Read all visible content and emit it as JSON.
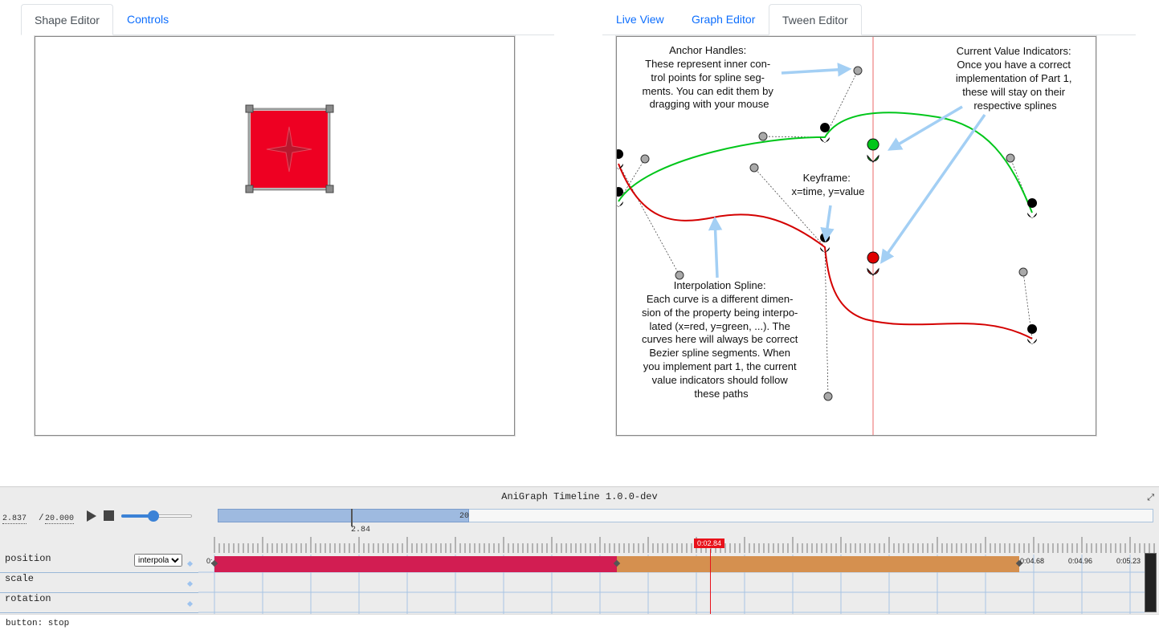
{
  "left_tabs": [
    {
      "label": "Shape Editor",
      "active": true
    },
    {
      "label": "Controls",
      "active": false
    }
  ],
  "right_tabs": [
    {
      "label": "Live View",
      "active": false
    },
    {
      "label": "Graph Editor",
      "active": false
    },
    {
      "label": "Tween Editor",
      "active": true
    }
  ],
  "shape_editor": {
    "shape_fill": "#ee0022",
    "star_color": "#b8182e",
    "handle_color": "#8a8a8a"
  },
  "tween_editor": {
    "annotations": {
      "anchor_handles": [
        "Anchor Handles:",
        "These represent inner con-",
        "trol points for spline seg-",
        "ments. You can edit them by",
        "dragging with your mouse"
      ],
      "current_value": [
        "Current Value Indicators:",
        "Once you have a correct",
        "implementation of Part 1,",
        "these will stay on their",
        "respective splines"
      ],
      "keyframe": [
        "Keyframe:",
        "x=time, y=value"
      ],
      "interpolation": [
        "Interpolation Spline:",
        "Each curve is a different dimen-",
        "sion of the property being interpo-",
        "lated (x=red, y=green, ...). The",
        "curves here will always be correct",
        "Bezier spline segments. When",
        "you implement part 1, the current",
        "value indicators should follow",
        "these paths"
      ]
    },
    "colors": {
      "x_curve": "#d40000",
      "y_curve": "#00c61a",
      "arrow": "#a3cff4",
      "time_line": "#f29a9a"
    }
  },
  "timeline": {
    "title": "AniGraph Timeline 1.0.0-dev",
    "current_time": "2.837",
    "separator": "/",
    "total_time": "20.000",
    "play_icon": "play-icon",
    "stop_icon": "stop-icon",
    "speed_slider_value": 0.5,
    "range_end_label": "20",
    "range_marker_label": "2.84",
    "playhead_label": "0:02.84",
    "rows": [
      {
        "label": "position"
      },
      {
        "label": "scale"
      },
      {
        "label": "rotation"
      }
    ],
    "interp_select": "interpolation",
    "time_labels": {
      "start": "0:",
      "t1": "0:04.68",
      "t2": "0:04.96",
      "t3": "0:05.23"
    },
    "segment_colors": [
      "#d21d52",
      "#d5904f"
    ],
    "status": "button: stop"
  }
}
